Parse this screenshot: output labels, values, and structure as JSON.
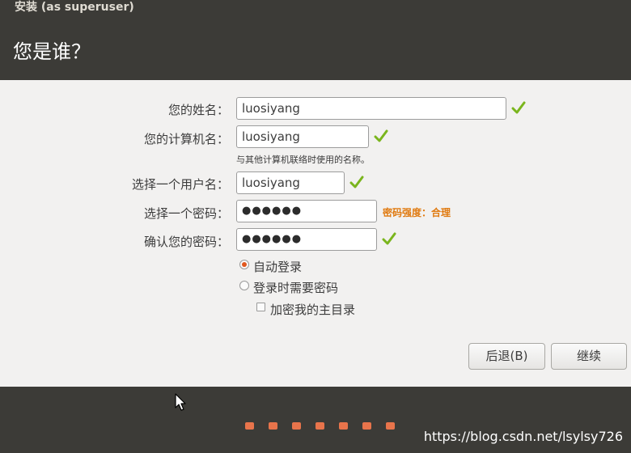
{
  "window": {
    "title": "安装 (as superuser)"
  },
  "page": {
    "title": "您是谁？"
  },
  "form": {
    "name_label": "您的姓名：",
    "name_value": "luosiyang",
    "computer_label": "您的计算机名：",
    "computer_value": "luosiyang",
    "computer_hint": "与其他计算机联络时使用的名称。",
    "username_label": "选择一个用户名：",
    "username_value": "luosiyang",
    "password_label": "选择一个密码：",
    "password_value": "●●●●●●",
    "password_strength": "密码强度：合理",
    "confirm_label": "确认您的密码：",
    "confirm_value": "●●●●●●",
    "login_auto": "自动登录",
    "login_require_password": "登录时需要密码",
    "encrypt_home": "加密我的主目录",
    "selected_login": "auto"
  },
  "buttons": {
    "back": "后退(B)",
    "continue": "继续"
  },
  "progress": {
    "total_steps": 7
  },
  "colors": {
    "check": "#7ab51d",
    "accent": "#e8744b",
    "strength": "#e07a10"
  },
  "watermark": "https://blog.csdn.net/lsylsy726"
}
